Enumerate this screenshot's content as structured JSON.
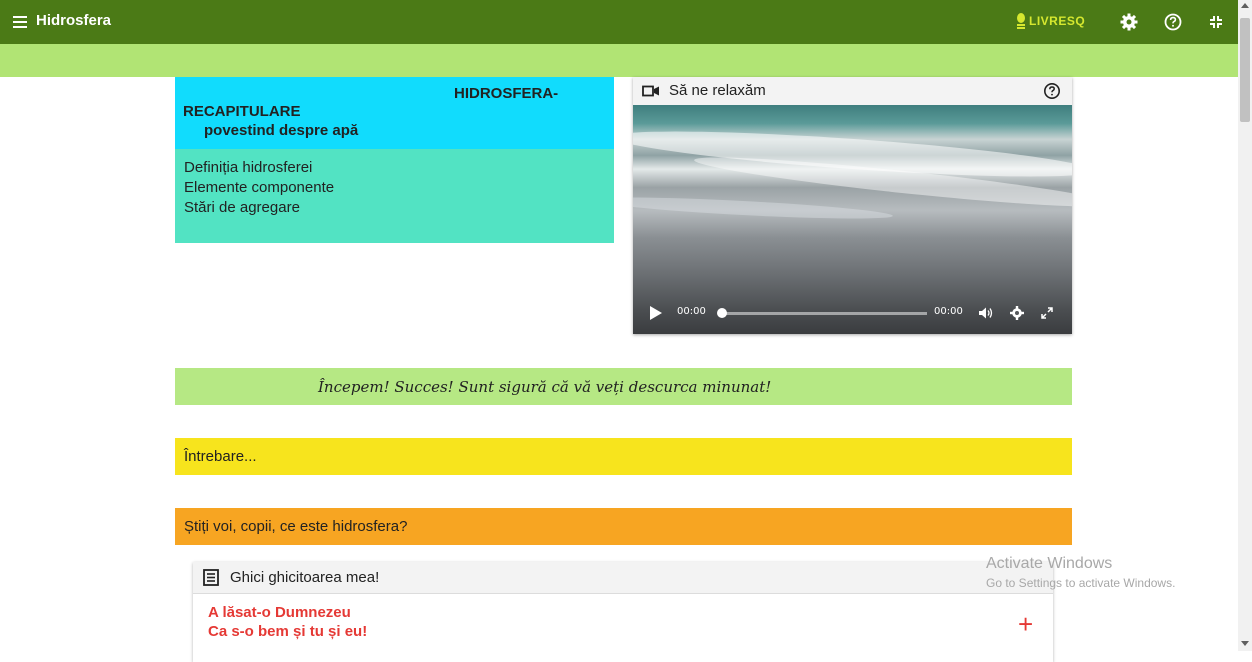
{
  "app": {
    "title": "Hidrosfera",
    "logo_text": "LIVRESQ"
  },
  "lesson": {
    "title_line1": "HIDROSFERA-",
    "title_line2": "RECAPITULARE",
    "subtitle": "povestind despre apă",
    "topics": [
      "Definiția hidrosferei",
      "Elemente componente",
      "Stări de agregare"
    ]
  },
  "video": {
    "title": "Să ne relaxăm",
    "current_time": "00:00",
    "duration": "00:00",
    "progress": 0
  },
  "banners": {
    "encouragement": "Începem! Succes! Sunt sigură că vă veți descurca minunat!",
    "question_header": "Întrebare...",
    "question": "Știți voi, copii, ce este hidrosfera?"
  },
  "riddle": {
    "title": "Ghici ghicitoarea mea!",
    "line1": "A lăsat-o Dumnezeu",
    "line2": "Ca s-o bem și tu și eu!",
    "expand": "+"
  },
  "watermark": {
    "line1": "Activate Windows",
    "line2": "Go to Settings to activate Windows."
  },
  "colors": {
    "topbar": "#4b7a16",
    "subbar": "#b1e474",
    "title_card": "#11dcfd",
    "topics_card": "#52e3c3",
    "green_banner": "#b6e884",
    "yellow_banner": "#f7e41d",
    "orange_banner": "#f7a522",
    "riddle_text": "#e53935"
  },
  "icons": {
    "menu": "hamburger-icon",
    "settings": "gear-icon",
    "help": "help-circle-icon",
    "exit_fullscreen": "exit-fullscreen-icon",
    "video": "video-camera-icon",
    "document": "document-icon"
  }
}
